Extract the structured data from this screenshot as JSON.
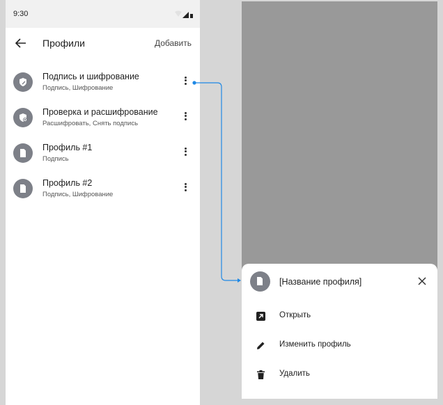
{
  "status_bar": {
    "time": "9:30"
  },
  "app_bar": {
    "title": "Профили",
    "add_label": "Добавить"
  },
  "profiles": [
    {
      "title": "Подпись и шифрование",
      "subtitle": "Подпись, Шифрование",
      "icon": "shield-pen-icon"
    },
    {
      "title": "Проверка и расшифрование",
      "subtitle": "Расшифровать, Снять подпись",
      "icon": "shield-check-icon"
    },
    {
      "title": "Профиль #1",
      "subtitle": "Подпись",
      "icon": "document-icon"
    },
    {
      "title": "Профиль #2",
      "subtitle": "Подпись, Шифрование",
      "icon": "document-icon"
    }
  ],
  "bottom_sheet": {
    "title": "[Название профиля]",
    "actions": [
      {
        "label": "Открыть",
        "icon": "open-external-icon"
      },
      {
        "label": "Изменить профиль",
        "icon": "edit-pencil-icon"
      },
      {
        "label": "Удалить",
        "icon": "trash-icon"
      }
    ]
  },
  "colors": {
    "avatar": "#7d8088",
    "connector": "#1e88e5",
    "overlay": "#999999"
  }
}
